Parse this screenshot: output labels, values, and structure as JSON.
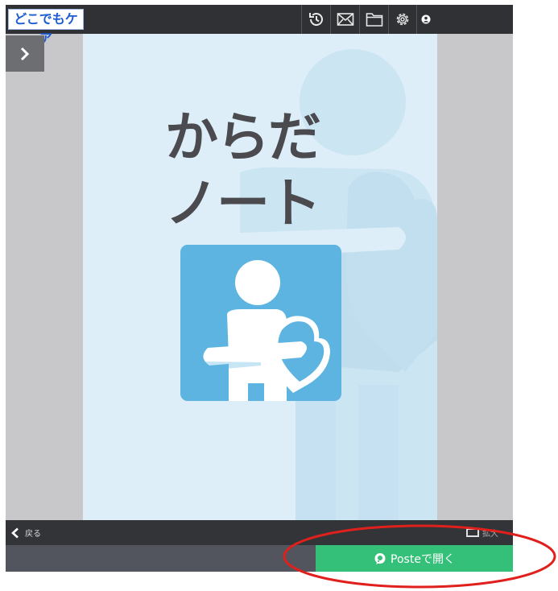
{
  "header": {
    "logo_text": "どこでもケア",
    "icons": [
      "history-icon",
      "mail-icon",
      "folder-icon",
      "settings-icon",
      "user-icon"
    ]
  },
  "document": {
    "title_line1": "からだ",
    "title_line2": "ノート"
  },
  "bottom_bar": {
    "back_label": "戻る",
    "expand_label": "拡大"
  },
  "footer": {
    "open_button_label": "Posteで開く"
  },
  "colors": {
    "top_bar": "#2f3135",
    "page_bg": "#ddeef8",
    "logo_tile": "#5db4e1",
    "open_button": "#35c07a",
    "annotation": "#e0201c"
  }
}
